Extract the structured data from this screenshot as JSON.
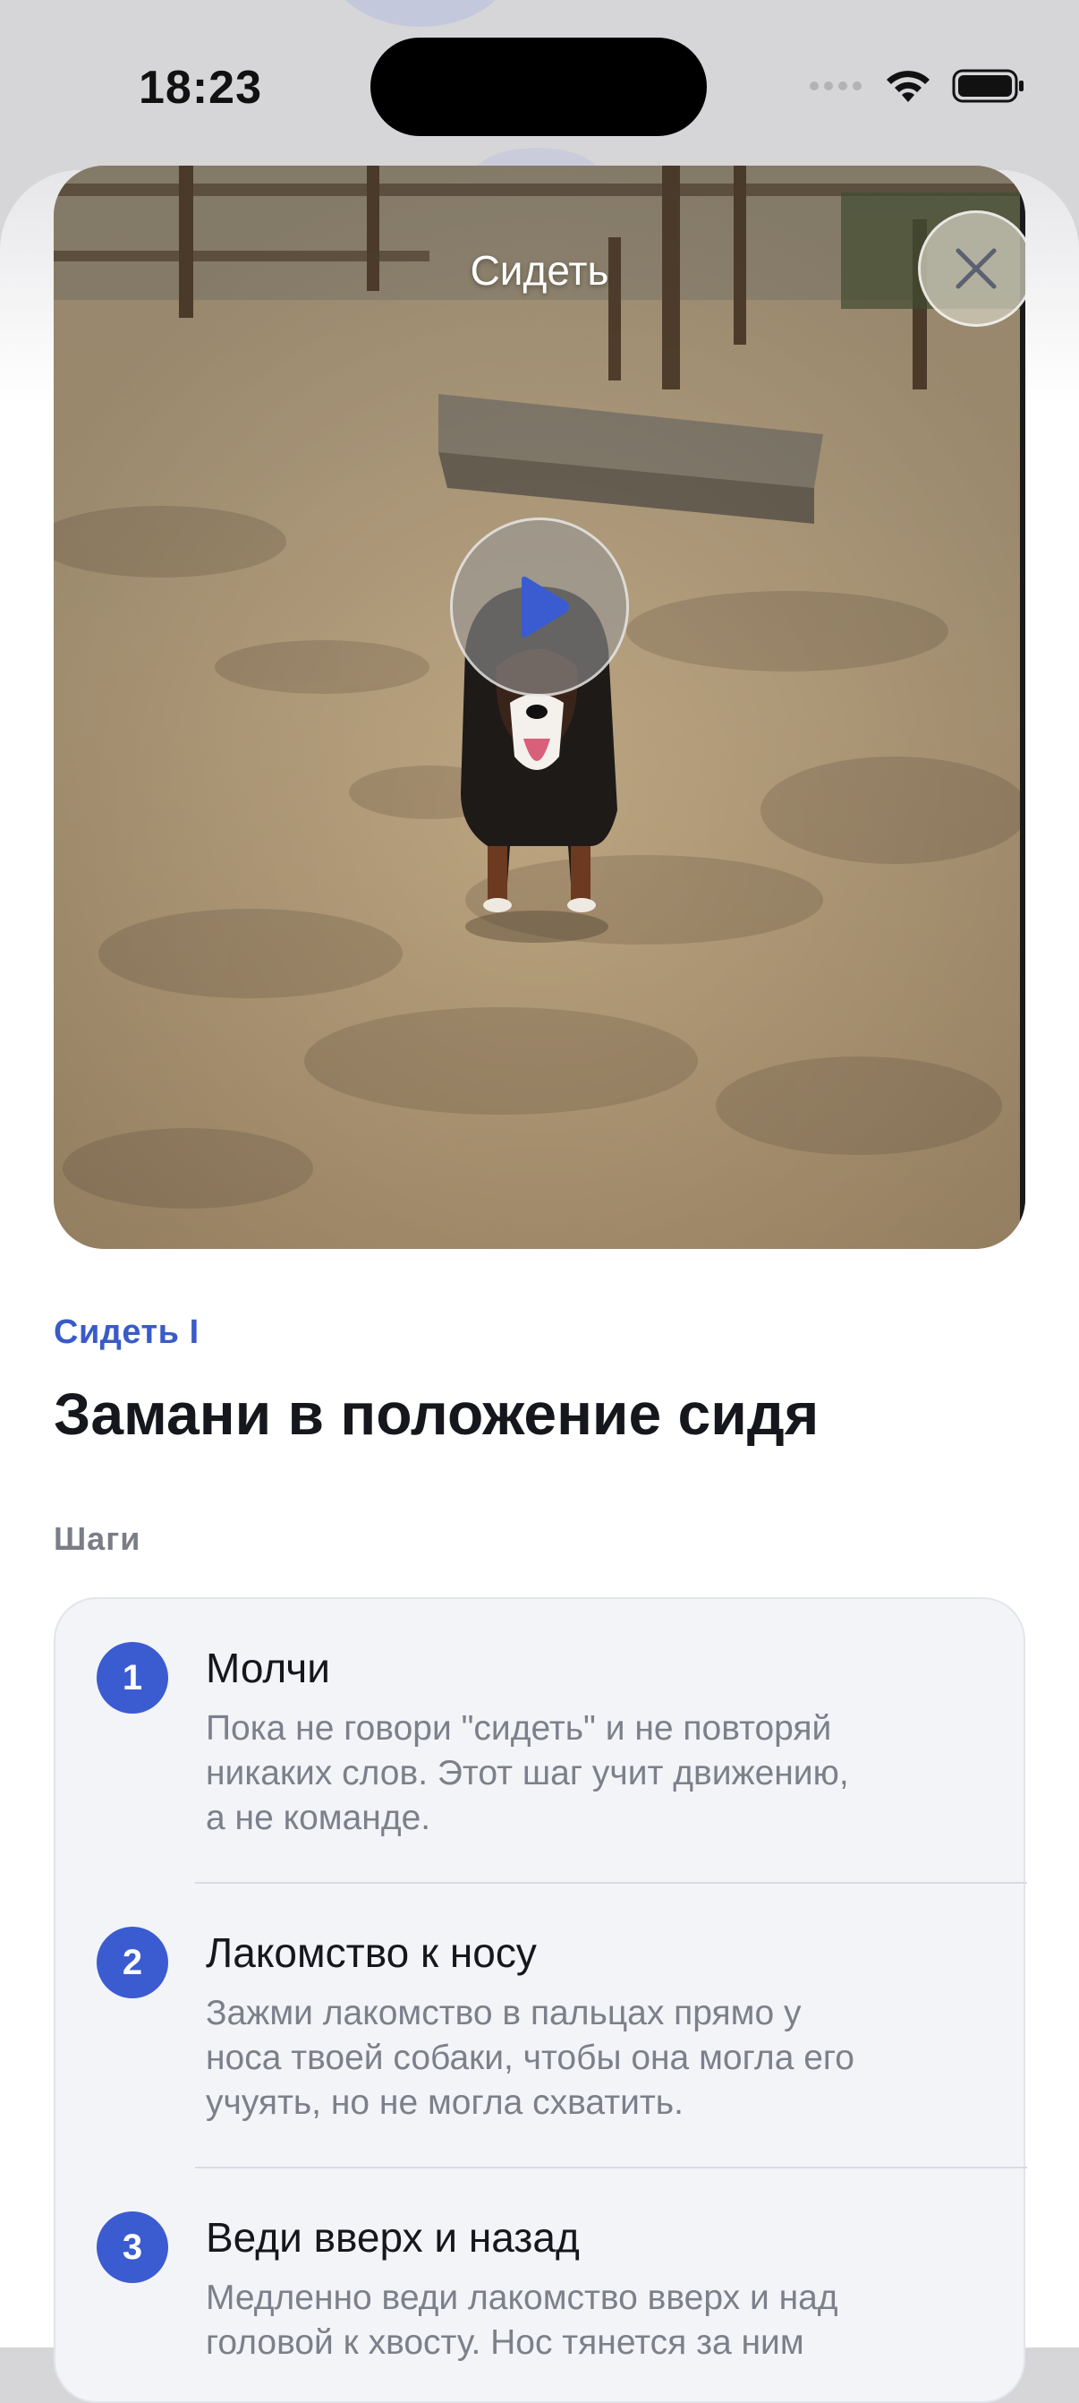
{
  "status_bar": {
    "time": "18:23"
  },
  "video": {
    "title": "Сидеть",
    "close_icon": "close-icon",
    "play_icon": "play-icon"
  },
  "lesson": {
    "category": "Сидеть I",
    "title": "Замани в положение сидя",
    "steps_label": "Шаги"
  },
  "steps": [
    {
      "number": "1",
      "title": "Молчи",
      "lines": [
        "Пока не говори \"сидеть\" и не повторяй",
        "никаких слов. Этот шаг учит движению,",
        "а не команде."
      ]
    },
    {
      "number": "2",
      "title": "Лакомство к носу",
      "lines": [
        "Зажми лакомство в пальцах прямо у",
        "носа твоей собаки, чтобы она могла его",
        "учуять, но не могла схватить."
      ]
    },
    {
      "number": "3",
      "title": "Веди вверх и назад",
      "lines": [
        "Медленно веди лакомство вверх и над",
        "головой к хвосту. Нос тянется за ним"
      ]
    }
  ],
  "colors": {
    "accent": "#3b5bd1",
    "category_text": "#3a5bc7"
  }
}
